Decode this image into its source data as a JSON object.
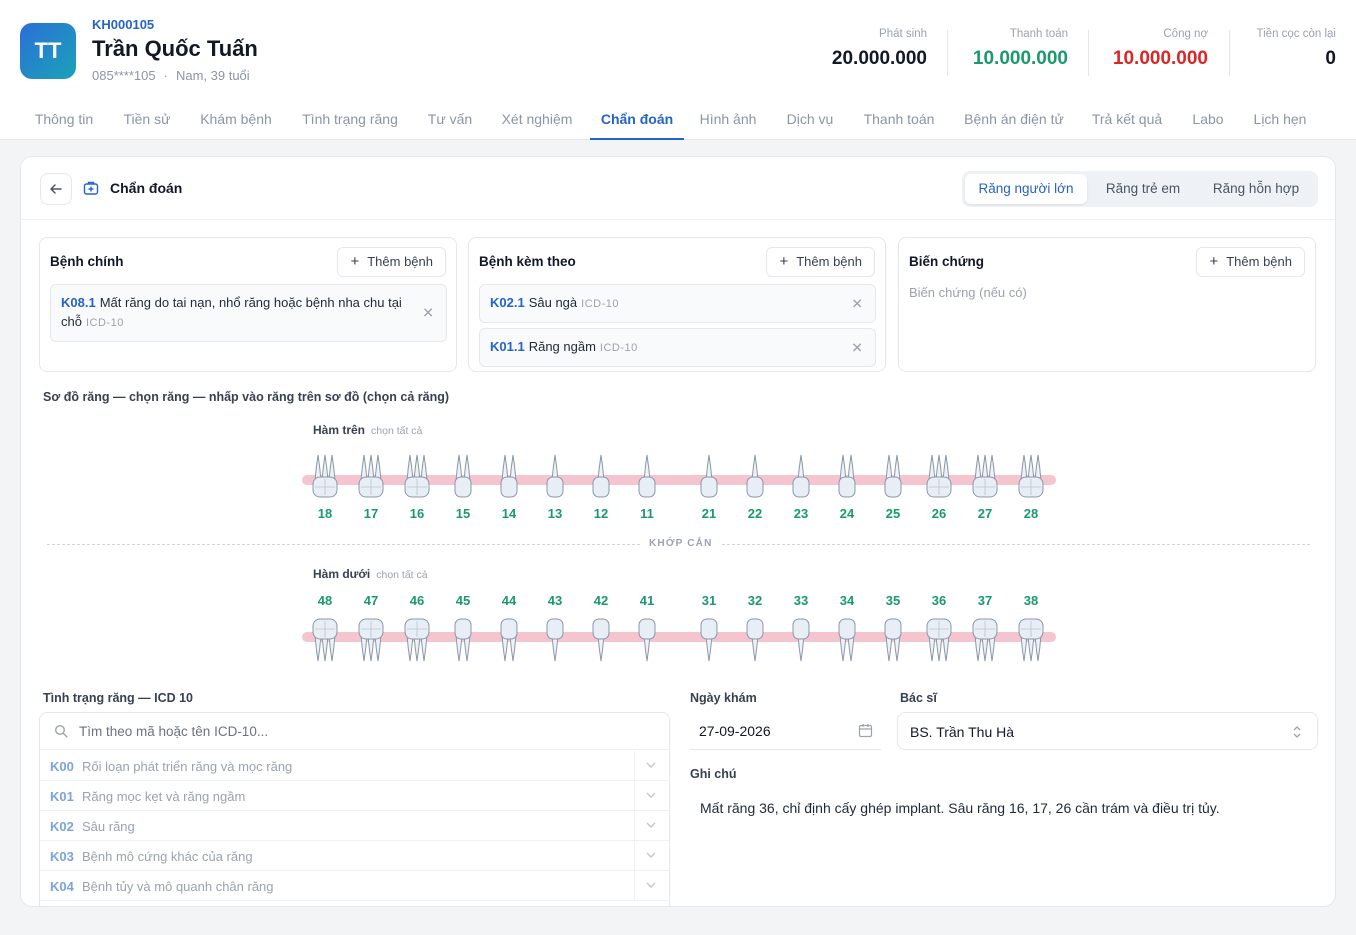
{
  "patient": {
    "initials": "TT",
    "id": "KH000105",
    "name": "Trần Quốc Tuấn",
    "phone": "085****105",
    "info": "Nam, 39 tuổi"
  },
  "stats": [
    {
      "label": "Phát sinh",
      "value": "20.000.000",
      "color": "#111827"
    },
    {
      "label": "Thanh toán",
      "value": "10.000.000",
      "color": "#1a9a6c"
    },
    {
      "label": "Công nợ",
      "value": "10.000.000",
      "color": "#dc2626"
    },
    {
      "label": "Tiền cọc còn lại",
      "value": "0",
      "color": "#111827"
    }
  ],
  "tabs": [
    "Thông tin",
    "Tiền sử",
    "Khám bệnh",
    "Tình trạng răng",
    "Tư vấn",
    "Xét nghiệm",
    "Chẩn đoán",
    "Hình ảnh",
    "Dịch vụ",
    "Thanh toán",
    "Bệnh án điện tử",
    "Trả kết quả",
    "Labo",
    "Lịch hẹn"
  ],
  "active_tab": "Chẩn đoán",
  "card": {
    "title": "Chẩn đoán",
    "segments": [
      "Răng người lớn",
      "Răng trẻ em",
      "Răng hỗn hợp"
    ],
    "active_segment": "Răng người lớn"
  },
  "diagnosis": {
    "add_label": "Thêm bệnh",
    "icd_tag": "ICD-10",
    "main": {
      "title": "Bệnh chính",
      "items": [
        {
          "code": "K08.1",
          "name": "Mất răng do tai nạn, nhổ răng hoặc bệnh nha chu tại chỗ"
        }
      ]
    },
    "secondary": {
      "title": "Bệnh kèm theo",
      "items": [
        {
          "code": "K02.1",
          "name": "Sâu ngà"
        },
        {
          "code": "K01.1",
          "name": "Răng ngầm"
        }
      ]
    },
    "complication": {
      "title": "Biến chứng",
      "placeholder": "Biến chứng (nếu có)"
    }
  },
  "tooth_chart": {
    "title": "Sơ đồ răng — chọn răng — nhấp vào răng trên sơ đồ (chọn cả răng)",
    "select_all": "chọn tất cả",
    "bite_label": "KHỚP CẮN",
    "upper": {
      "label": "Hàm trên",
      "teeth": [
        "18",
        "17",
        "16",
        "15",
        "14",
        "13",
        "12",
        "11",
        "21",
        "22",
        "23",
        "24",
        "25",
        "26",
        "27",
        "28"
      ]
    },
    "lower": {
      "label": "Hàm dưới",
      "teeth": [
        "48",
        "47",
        "46",
        "45",
        "44",
        "43",
        "42",
        "41",
        "31",
        "32",
        "33",
        "34",
        "35",
        "36",
        "37",
        "38"
      ]
    }
  },
  "icd": {
    "title": "Tình trạng răng — ICD 10",
    "search_placeholder": "Tìm theo mã hoặc tên ICD-10...",
    "rows": [
      {
        "code": "K00",
        "name": "Rối loạn phát triển răng và mọc răng"
      },
      {
        "code": "K01",
        "name": "Răng mọc kẹt và răng ngầm"
      },
      {
        "code": "K02",
        "name": "Sâu răng"
      },
      {
        "code": "K03",
        "name": "Bệnh mô cứng khác của răng"
      },
      {
        "code": "K04",
        "name": "Bệnh tủy và mô quanh chân răng"
      }
    ]
  },
  "exam": {
    "date_label": "Ngày khám",
    "date_value": "27-09-2026",
    "doctor_label": "Bác sĩ",
    "doctor_value": "BS. Trần Thu Hà",
    "note_label": "Ghi chú",
    "note_value": "Mất răng 36, chỉ định cấy ghép implant. Sâu răng 16, 17, 26 cần trám và điều trị tủy."
  },
  "colors": {
    "accent": "#2563c9",
    "success": "#1a9a6c",
    "danger": "#dc2626",
    "gum": "#f4c4cf"
  }
}
